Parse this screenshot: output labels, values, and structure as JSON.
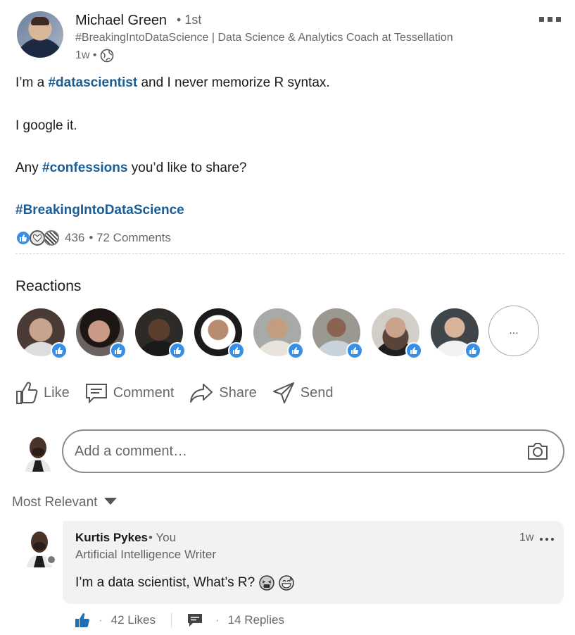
{
  "post": {
    "author": {
      "name": "Michael Green",
      "degree": "• 1st",
      "headline": "#BreakingIntoDataScience | Data Science & Analytics Coach at Tessellation",
      "time": "1w •"
    },
    "body": {
      "line1_prefix": "I’m a ",
      "line1_hashtag": "#datascientist",
      "line1_suffix": " and I never memorize R syntax.",
      "line2": "I google it.",
      "line3_prefix": "Any ",
      "line3_hashtag": "#confessions",
      "line3_suffix": " you’d like to share?",
      "line4_hashtag": "#BreakingIntoDataScience"
    },
    "social": {
      "count": "436",
      "comments": "• 72 Comments"
    }
  },
  "reactions": {
    "title": "Reactions",
    "more_label": "...",
    "people": [
      {
        "name": "reactor-1",
        "color": "#5a4a45"
      },
      {
        "name": "reactor-2",
        "color": "#3d3533"
      },
      {
        "name": "reactor-3",
        "color": "#2a2623"
      },
      {
        "name": "reactor-4",
        "color": "#6b6a67"
      },
      {
        "name": "reactor-5",
        "color": "#9a9c98"
      },
      {
        "name": "reactor-6",
        "color": "#8e8c86"
      },
      {
        "name": "reactor-7",
        "color": "#b9b5ae"
      },
      {
        "name": "reactor-8",
        "color": "#4f5457"
      }
    ]
  },
  "actions": {
    "like": "Like",
    "comment": "Comment",
    "share": "Share",
    "send": "Send"
  },
  "comment_box": {
    "placeholder": "Add a comment…"
  },
  "sort": {
    "label": "Most Relevant"
  },
  "comment": {
    "name": "Kurtis Pykes",
    "you": "• You",
    "headline": "Artificial Intelligence Writer",
    "time": "1w",
    "text": "I’m a data scientist, What’s R?",
    "likes": "42 Likes",
    "replies": "14 Replies"
  },
  "colors": {
    "hashtag": "#1a5c93",
    "like_blue": "#378fe9",
    "text_secondary": "rgba(0,0,0,0.6)"
  }
}
